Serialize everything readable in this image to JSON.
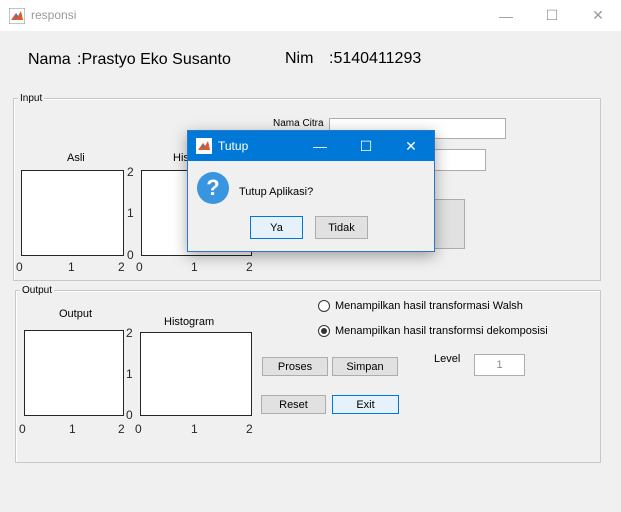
{
  "window": {
    "title": "responsi",
    "minimize": "—",
    "maximize": "☐",
    "close": "✕"
  },
  "header": {
    "nama_label": "Nama",
    "nama_value": ":Prastyo Eko Susanto",
    "nim_label": "Nim",
    "nim_value": ":5140411293"
  },
  "input_panel": {
    "title": "Input",
    "nama_citra_label": "Nama Citra",
    "nama_citra_value": "",
    "asli_axes": {
      "title": "Asli",
      "xticks": [
        "0",
        "1",
        "2"
      ]
    },
    "histogram_axes": {
      "title": "Histogram",
      "yticks": [
        "2",
        "1",
        "0"
      ],
      "xticks": [
        "0",
        "1",
        "2"
      ]
    }
  },
  "output_panel": {
    "title": "Output",
    "output_axes": {
      "title": "Output",
      "xticks": [
        "0",
        "1",
        "2"
      ]
    },
    "histogram_axes": {
      "title": "Histogram",
      "yticks": [
        "2",
        "1",
        "0"
      ],
      "xticks": [
        "0",
        "1",
        "2"
      ]
    },
    "radio_walsh": {
      "label": "Menampilkan hasil transformasi Walsh",
      "checked": false
    },
    "radio_dekomposisi": {
      "label": "Menampilkan hasil transformsi dekomposisi",
      "checked": true
    },
    "level_label": "Level",
    "level_value": "1",
    "buttons": {
      "proses": "Proses",
      "simpan": "Simpan",
      "reset": "Reset",
      "exit": "Exit"
    }
  },
  "dialog": {
    "title": "Tutup",
    "icon": "question-icon",
    "message": "Tutup Aplikasi?",
    "yes_label": "Ya",
    "no_label": "Tidak",
    "minimize": "—",
    "maximize": "☐",
    "close": "✕"
  },
  "colors": {
    "dialog_titlebar": "#0078d7",
    "question_icon": "#3a95e0",
    "focus_border": "#0078d7"
  }
}
